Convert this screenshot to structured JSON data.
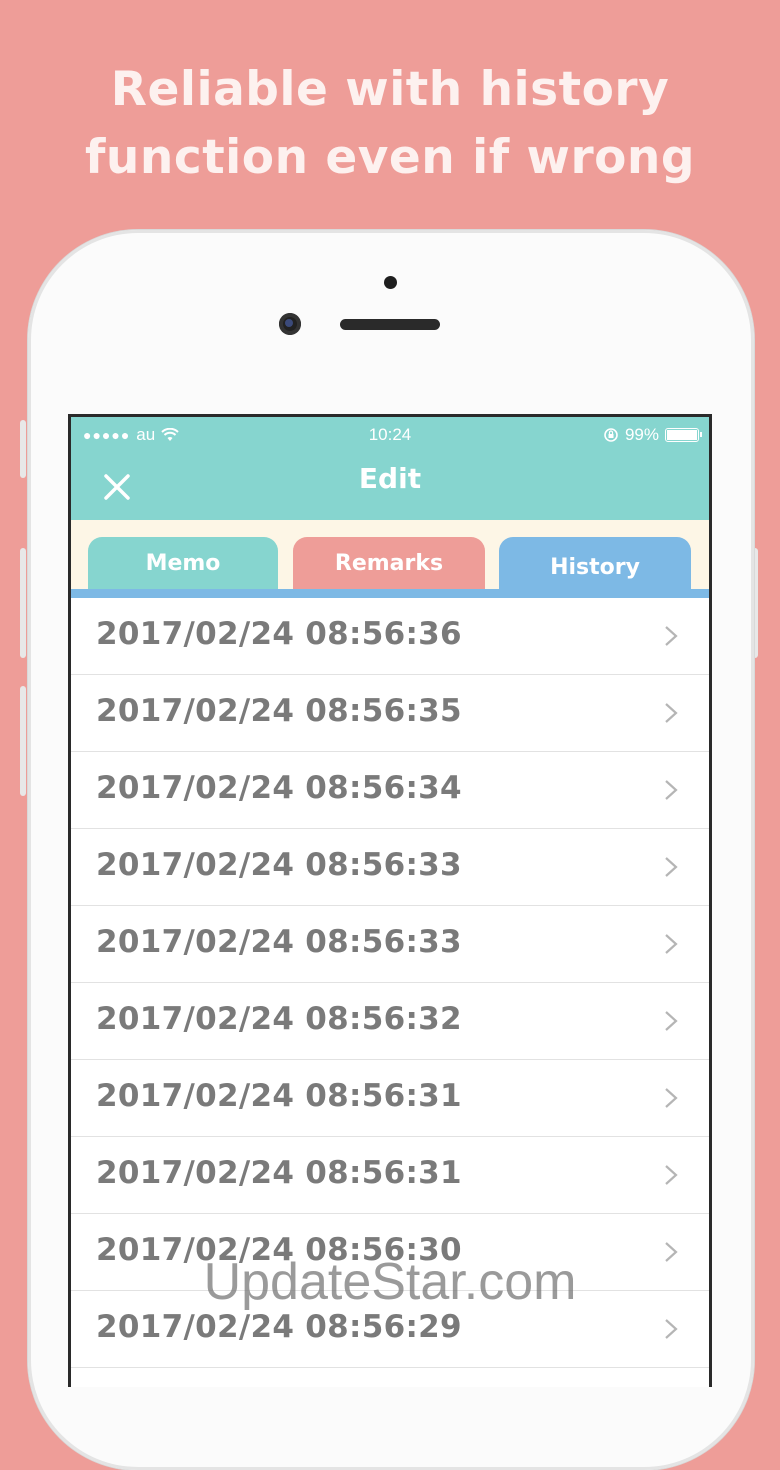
{
  "headline": {
    "line1": "Reliable with history",
    "line2": "function even if wrong"
  },
  "status_bar": {
    "carrier": "au",
    "time": "10:24",
    "battery": "99%"
  },
  "nav": {
    "title": "Edit"
  },
  "tabs": [
    {
      "label": "Memo"
    },
    {
      "label": "Remarks"
    },
    {
      "label": "History"
    }
  ],
  "history": [
    "2017/02/24 08:56:36",
    "2017/02/24 08:56:35",
    "2017/02/24 08:56:34",
    "2017/02/24 08:56:33",
    "2017/02/24 08:56:33",
    "2017/02/24 08:56:32",
    "2017/02/24 08:56:31",
    "2017/02/24 08:56:31",
    "2017/02/24 08:56:30",
    "2017/02/24 08:56:29"
  ],
  "watermark": "UpdateStar.com",
  "colors": {
    "background": "#ee9d98",
    "navbar": "#86d5cf",
    "memo_tab": "#86d5cf",
    "remarks_tab": "#ee9d98",
    "history_tab": "#7db9e5"
  }
}
